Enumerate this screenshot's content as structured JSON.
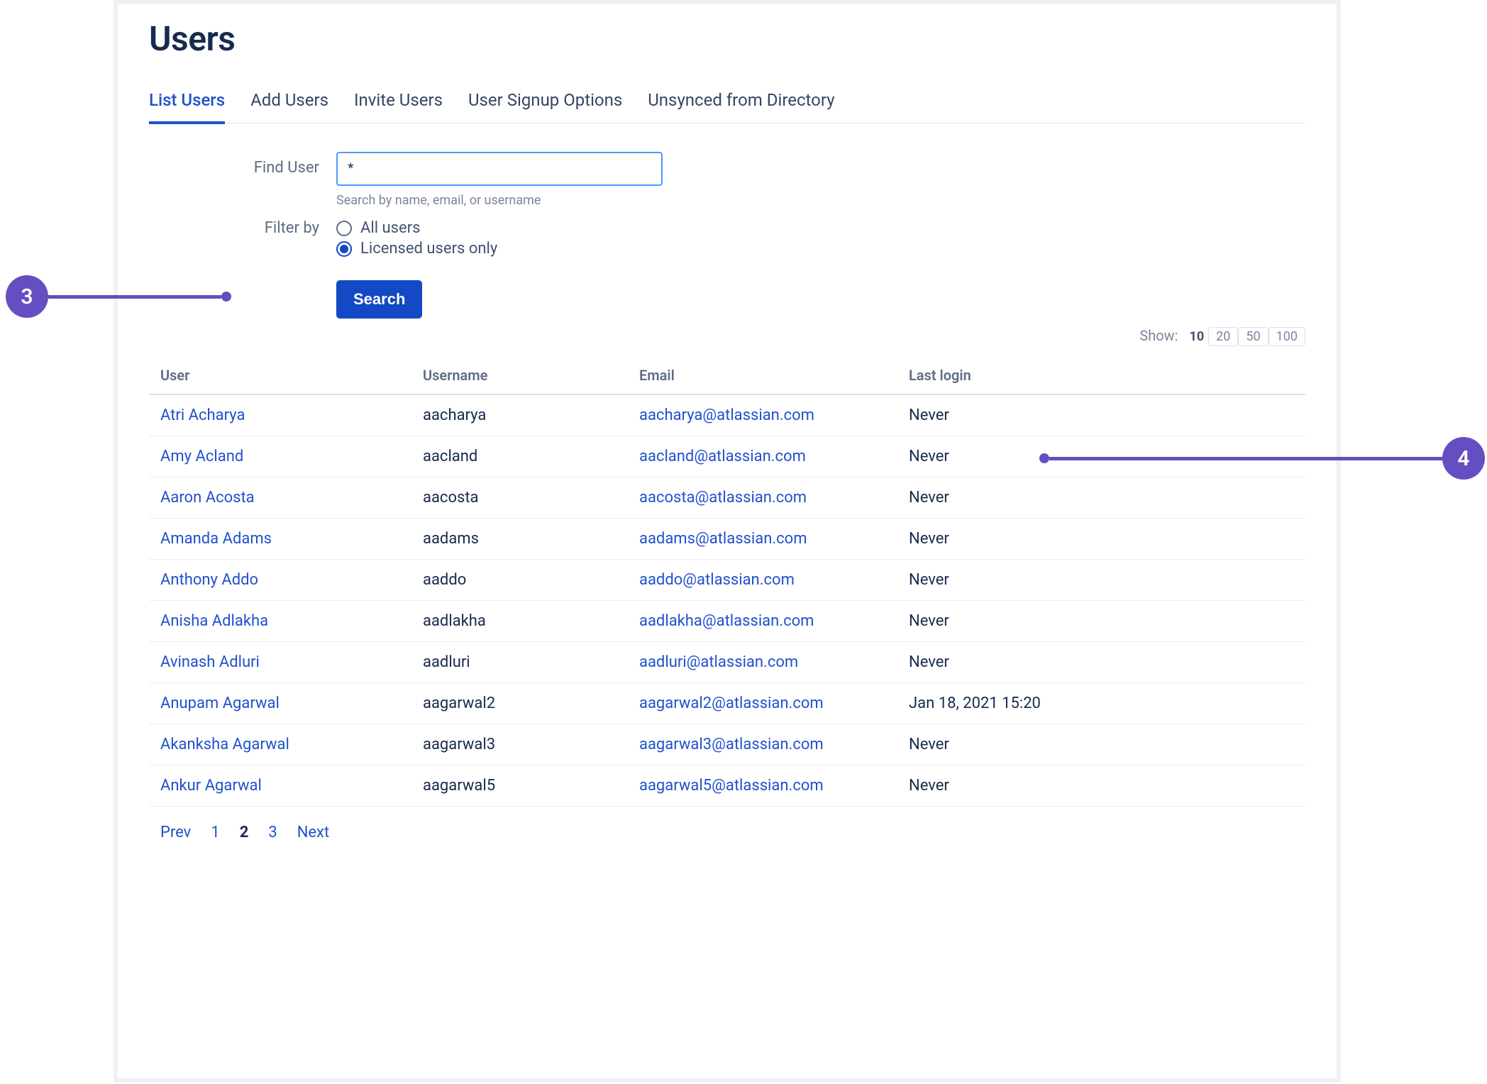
{
  "page_title": "Users",
  "tabs": [
    {
      "label": "List Users",
      "active": true
    },
    {
      "label": "Add Users",
      "active": false
    },
    {
      "label": "Invite Users",
      "active": false
    },
    {
      "label": "User Signup Options",
      "active": false
    },
    {
      "label": "Unsynced from Directory",
      "active": false
    }
  ],
  "form": {
    "find_user_label": "Find User",
    "find_user_value": "*",
    "find_user_hint": "Search by name, email, or username",
    "filter_by_label": "Filter by",
    "filter_options": [
      {
        "label": "All users",
        "checked": false
      },
      {
        "label": "Licensed users only",
        "checked": true
      }
    ],
    "search_button": "Search"
  },
  "show": {
    "label": "Show:",
    "options": [
      {
        "value": "10",
        "active": true
      },
      {
        "value": "20",
        "active": false
      },
      {
        "value": "50",
        "active": false
      },
      {
        "value": "100",
        "active": false
      }
    ]
  },
  "table": {
    "headers": {
      "user": "User",
      "username": "Username",
      "email": "Email",
      "last_login": "Last login"
    },
    "rows": [
      {
        "user": "Atri Acharya",
        "username": "aacharya",
        "email": "aacharya@atlassian.com",
        "last_login": "Never"
      },
      {
        "user": "Amy Acland",
        "username": "aacland",
        "email": "aacland@atlassian.com",
        "last_login": "Never"
      },
      {
        "user": "Aaron Acosta",
        "username": "aacosta",
        "email": "aacosta@atlassian.com",
        "last_login": "Never"
      },
      {
        "user": "Amanda Adams",
        "username": "aadams",
        "email": "aadams@atlassian.com",
        "last_login": "Never"
      },
      {
        "user": "Anthony Addo",
        "username": "aaddo",
        "email": "aaddo@atlassian.com",
        "last_login": "Never"
      },
      {
        "user": "Anisha Adlakha",
        "username": "aadlakha",
        "email": "aadlakha@atlassian.com",
        "last_login": "Never"
      },
      {
        "user": "Avinash Adluri",
        "username": "aadluri",
        "email": "aadluri@atlassian.com",
        "last_login": "Never"
      },
      {
        "user": "Anupam Agarwal",
        "username": "aagarwal2",
        "email": "aagarwal2@atlassian.com",
        "last_login": "Jan 18, 2021 15:20"
      },
      {
        "user": "Akanksha Agarwal",
        "username": "aagarwal3",
        "email": "aagarwal3@atlassian.com",
        "last_login": "Never"
      },
      {
        "user": "Ankur Agarwal",
        "username": "aagarwal5",
        "email": "aagarwal5@atlassian.com",
        "last_login": "Never"
      }
    ]
  },
  "pagination": {
    "prev": "Prev",
    "pages": [
      {
        "label": "1",
        "current": false
      },
      {
        "label": "2",
        "current": true
      },
      {
        "label": "3",
        "current": false
      }
    ],
    "next": "Next"
  },
  "callouts": {
    "left": "3",
    "right": "4"
  }
}
